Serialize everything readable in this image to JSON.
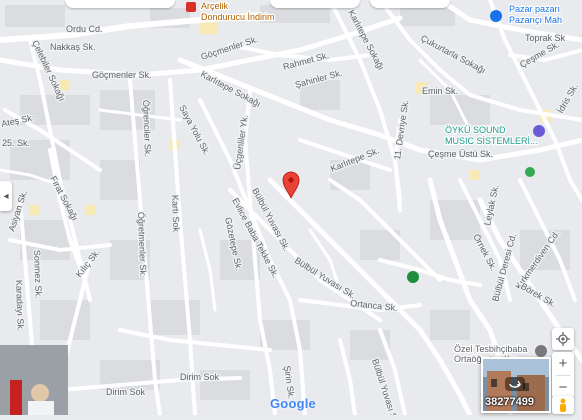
{
  "map": {
    "streets": [
      "Ordu Cd.",
      "Nakkaş Sk.",
      "Çelebiler Sokağı",
      "Göçmenler Sk.",
      "Göçmenler Sk.",
      "Rahmet Sk.",
      "Şahinler Sk.",
      "Karlıtepe Sokağı",
      "Karlıtepe Sk.",
      "Karlıtepe Sokağı",
      "Ateş Sk.",
      "25. Sk.",
      "Öğrenciler Sk.",
      "Saya Yolu Sk.",
      "Üçgenliler Yk.",
      "11. Devriye Sk.",
      "Çukurtarla Sokağı",
      "Emin Sk.",
      "Toprak Sk",
      "Çeşme Sk.",
      "İdris Sk.",
      "Çeşme Üstü Sk.",
      "Asiyan Sk.",
      "Fırat Sokağı",
      "Öğretmenler Sk.",
      "Kartı Sok",
      "Gözetepe Sk.",
      "Evlice Baba Tekke Sk.",
      "Bülbül Yuvası Sk.",
      "Bülbül Yuvası Sk.",
      "Leylak Sk.",
      "Örnek Sk.",
      "Bülbül Deresi Cd.",
      "Kırkmerdiven Cd.",
      "Börek Sk.",
      "Sonmez Sk.",
      "Kılıç Sk.",
      "Karadayı Sk.",
      "Ortanca Sk.",
      "Bülbül Yuvası Sk.",
      "Dirim Sok",
      "Dirim Sok",
      "Şirin Sk."
    ],
    "pois": {
      "arcelik": "Arçelik",
      "dondurma": "Dondurucu İndirim",
      "pazar_1": "Pazar pazarı",
      "pazar_2": "Pazarıçı Mah",
      "oyku_1": "ÖYKÜ SOUND",
      "oyku_2": "MUSIC SİSTEMLERİ...",
      "tesbih_1": "Özel Tesbihçibaba",
      "tesbih_2": "Ortaöğretim Kız..."
    },
    "google_logo": "Google",
    "street_view_caption": "38277499"
  },
  "colors": {
    "road": "#ffffff",
    "pin": "#ea4335",
    "poi_teal": "#1a9b8a",
    "poi_purple": "#6b5bd6",
    "poi_gray": "#7a7a7a"
  },
  "icons": {
    "pin": "location-pin-icon",
    "collapse": "chevron-left-icon",
    "locate": "my-location-icon",
    "zoom_in": "plus-icon",
    "zoom_out": "minus-icon",
    "pegman": "pegman-icon"
  },
  "controls": {
    "collapse": "◂",
    "zoom_in": "+",
    "zoom_out": "−"
  }
}
